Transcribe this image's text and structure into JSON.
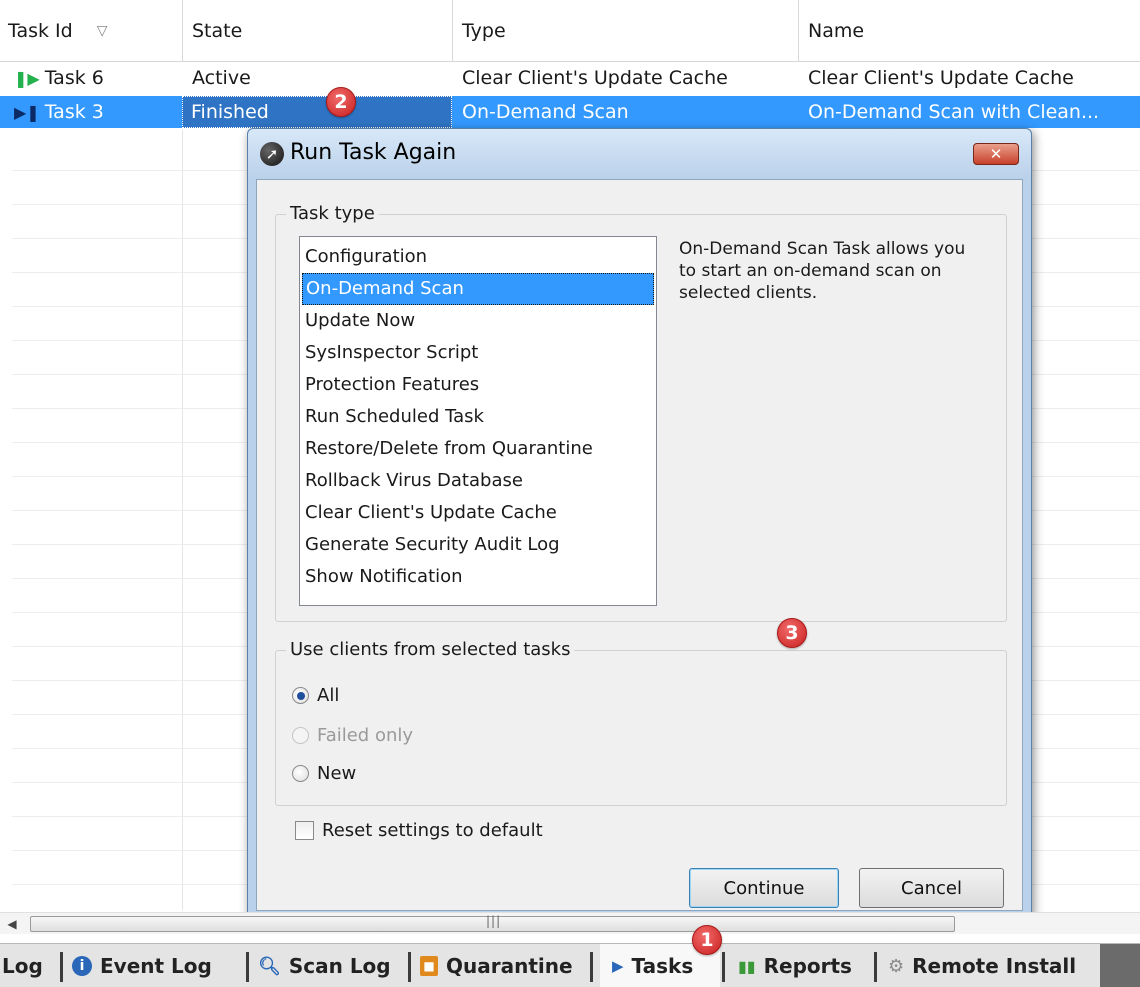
{
  "table": {
    "columns": [
      {
        "label": "Task Id",
        "sort_icon": "sort-descending-icon"
      },
      {
        "label": "State"
      },
      {
        "label": "Type"
      },
      {
        "label": "Name"
      }
    ],
    "rows": [
      {
        "task_id": "Task 6",
        "status_icon": "play-icon",
        "state": "Active",
        "type": "Clear Client's Update Cache",
        "name": "Clear Client's Update Cache"
      },
      {
        "task_id": "Task 3",
        "status_icon": "finished-icon",
        "state": "Finished",
        "type": "On-Demand Scan",
        "name": "On-Demand Scan with Clean..."
      }
    ]
  },
  "dialog": {
    "title": "Run Task Again",
    "close_glyph": "✕",
    "task_type": {
      "legend": "Task type",
      "items": [
        "Configuration",
        "On-Demand Scan",
        "Update Now",
        "SysInspector Script",
        "Protection Features",
        "Run Scheduled Task",
        "Restore/Delete from Quarantine",
        "Rollback Virus Database",
        "Clear Client's Update Cache",
        "Generate Security Audit Log",
        "Show Notification"
      ],
      "selected": "On-Demand Scan",
      "description": "On-Demand Scan Task allows you to start an on-demand scan on selected clients."
    },
    "clients": {
      "legend": "Use clients from selected tasks",
      "options": [
        {
          "label": "All",
          "checked": true,
          "enabled": true
        },
        {
          "label": "Failed only",
          "checked": false,
          "enabled": false
        },
        {
          "label": "New",
          "checked": false,
          "enabled": true
        }
      ]
    },
    "reset_label": "Reset settings to default",
    "reset_checked": false,
    "continue_label": "Continue",
    "cancel_label": "Cancel"
  },
  "tabs": [
    {
      "label": "Log",
      "icon": ""
    },
    {
      "label": "Event Log",
      "icon": "info-icon"
    },
    {
      "label": "Scan Log",
      "icon": "magnifier-icon"
    },
    {
      "label": "Quarantine",
      "icon": "lock-icon"
    },
    {
      "label": "Tasks",
      "icon": "play-icon",
      "active": true
    },
    {
      "label": "Reports",
      "icon": "bar-chart-icon"
    },
    {
      "label": "Remote Install",
      "icon": "gear-icon"
    }
  ],
  "markers": [
    "1",
    "2",
    "3"
  ],
  "colors": {
    "selection": "#3399ff",
    "marker": "#d62b2b",
    "dialog_frame": "#b9d1ea",
    "dialog_client": "#f0f0f0",
    "play_green": "#22b14c"
  }
}
